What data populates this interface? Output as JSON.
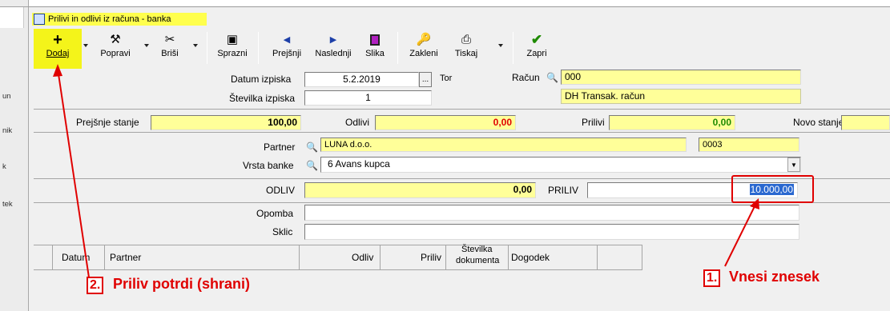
{
  "left_strip": {
    "labels": [
      "un",
      "nik",
      "k",
      "tek"
    ]
  },
  "window": {
    "title": "Prilivi in odlivi iz računa - banka"
  },
  "toolbar": {
    "buttons": [
      {
        "label": "Dodaj",
        "icon": "plus-icon"
      },
      {
        "label": "Popravi",
        "icon": "hammer-icon"
      },
      {
        "label": "Briši",
        "icon": "scissors-icon"
      },
      {
        "label": "Sprazni",
        "icon": "clear-icon"
      },
      {
        "label": "Prejšnji",
        "icon": "arrow-left-icon"
      },
      {
        "label": "Naslednji",
        "icon": "arrow-right-icon"
      },
      {
        "label": "Slika",
        "icon": "image-icon"
      },
      {
        "label": "Zakleni",
        "icon": "lock-icon"
      },
      {
        "label": "Tiskaj",
        "icon": "printer-icon"
      },
      {
        "label": "Zapri",
        "icon": "check-icon"
      }
    ]
  },
  "form": {
    "datum_izpiska_label": "Datum izpiska",
    "datum_izpiska_value": "5.2.2019",
    "datum_btn": "...",
    "day_name": "Tor",
    "racun_label": "Račun",
    "racun_value": "000",
    "racun_name": "DH Transak. račun",
    "stevilka_izpiska_label": "Številka izpiska",
    "stevilka_izpiska_value": "1",
    "prejsnje_stanje_label": "Prejšnje stanje",
    "prejsnje_stanje_value": "100,00",
    "odlivi_label": "Odlivi",
    "odlivi_value": "0,00",
    "prilivi_label": "Prilivi",
    "prilivi_value": "0,00",
    "novo_stanje_label": "Novo stanje",
    "partner_label": "Partner",
    "partner_value": "LUNA d.o.o.",
    "partner_code": "0003",
    "vrsta_banke_label": "Vrsta banke",
    "vrsta_banke_value": "6 Avans kupca",
    "odliv_label": "ODLIV",
    "odliv_value": "0,00",
    "priliv_label": "PRILIV",
    "priliv_value": "10.000,00",
    "opomba_label": "Opomba",
    "sklic_label": "Sklic"
  },
  "grid": {
    "columns": [
      "Datum",
      "Partner",
      "Odliv",
      "Priliv",
      "Številka",
      "dokumenta",
      "Dogodek"
    ]
  },
  "annotations": {
    "step1_num": "1.",
    "step1_text": "Vnesi znesek",
    "step2_num": "2.",
    "step2_text": "Priliv potrdi (shrani)",
    "color": "#e00000"
  }
}
